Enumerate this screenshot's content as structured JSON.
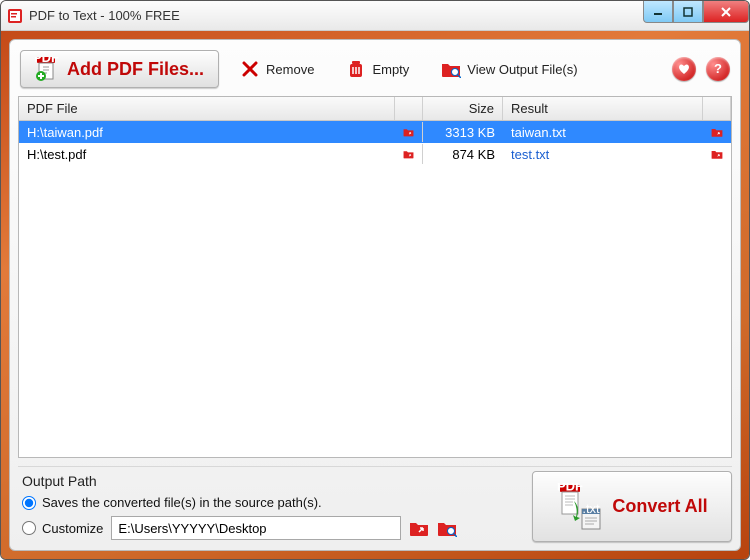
{
  "window": {
    "title": "PDF to Text - 100% FREE"
  },
  "toolbar": {
    "add_label": "Add PDF Files...",
    "remove_label": "Remove",
    "empty_label": "Empty",
    "view_output_label": "View Output File(s)"
  },
  "table": {
    "headers": {
      "file": "PDF File",
      "size": "Size",
      "result": "Result"
    },
    "rows": [
      {
        "file": "H:\\taiwan.pdf",
        "size": "3313 KB",
        "result": "taiwan.txt",
        "selected": true
      },
      {
        "file": "H:\\test.pdf",
        "size": "874 KB",
        "result": "test.txt",
        "selected": false
      }
    ]
  },
  "output": {
    "legend": "Output Path",
    "same_label": "Saves the converted file(s) in the source path(s).",
    "customize_label": "Customize",
    "path_value": "E:\\Users\\YYYYY\\Desktop",
    "selected": "same"
  },
  "convert": {
    "label": "Convert All"
  }
}
